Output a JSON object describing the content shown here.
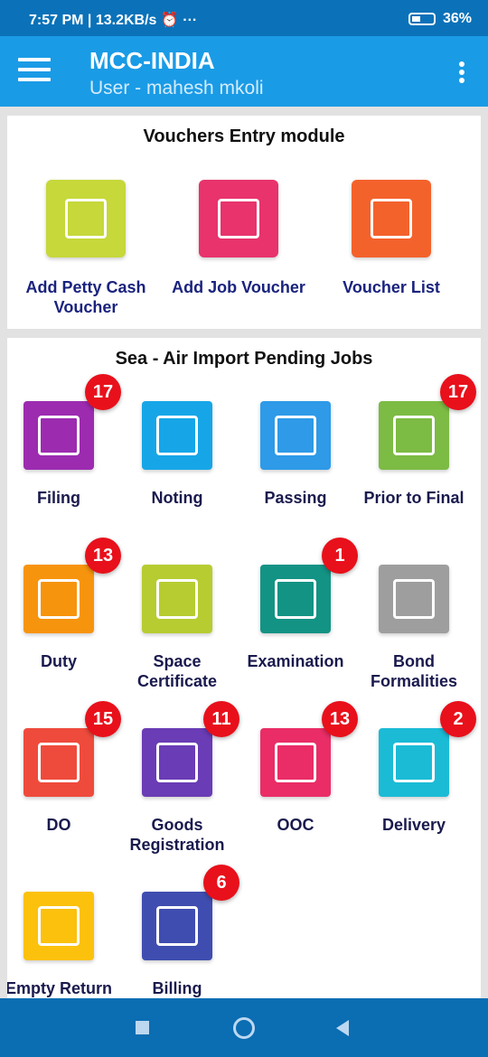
{
  "status": {
    "left": "7:57 PM | 13.2KB/s ⏰ ···",
    "battery": "36%"
  },
  "appbar": {
    "title": "MCC-INDIA",
    "subtitle": "User - mahesh mkoli"
  },
  "vouchers": {
    "heading": "Vouchers Entry module",
    "items": [
      {
        "label": "Add Petty Cash Voucher",
        "color": "#c6d83a",
        "icon": "petty-cash-icon"
      },
      {
        "label": "Add Job Voucher",
        "color": "#e8336d",
        "icon": "job-voucher-icon"
      },
      {
        "label": "Voucher List",
        "color": "#f4622c",
        "icon": "voucher-list-icon"
      }
    ]
  },
  "jobs": {
    "heading": "Sea - Air Import Pending Jobs",
    "items": [
      {
        "label": "Filing",
        "badge": "17",
        "color": "#9c2bb0",
        "icon": "filing-cabinet-icon"
      },
      {
        "label": "Noting",
        "badge": "",
        "color": "#16a6e8",
        "icon": "noting-icon"
      },
      {
        "label": "Passing",
        "badge": "",
        "color": "#2e9ae8",
        "icon": "passing-icon"
      },
      {
        "label": "Prior to Final",
        "badge": "17",
        "color": "#7cbb44",
        "icon": "ticket-icon"
      },
      {
        "label": "Duty",
        "badge": "13",
        "color": "#f7940d",
        "icon": "duty-icon"
      },
      {
        "label": "Space Certificate",
        "badge": "",
        "color": "#b7cc31",
        "icon": "certificate-icon"
      },
      {
        "label": "Examination",
        "badge": "1",
        "color": "#139384",
        "icon": "examination-icon"
      },
      {
        "label": "Bond Formalities",
        "badge": "",
        "color": "#9e9e9e",
        "icon": "bond-icon"
      },
      {
        "label": "DO",
        "badge": "15",
        "color": "#ef4b3c",
        "icon": "do-document-icon"
      },
      {
        "label": "Goods Registration",
        "badge": "11",
        "color": "#6a3cb5",
        "icon": "user-edit-icon"
      },
      {
        "label": "OOC",
        "badge": "13",
        "color": "#ea2d66",
        "icon": "ooc-icon"
      },
      {
        "label": "Delivery",
        "badge": "2",
        "color": "#1bbbd6",
        "icon": "delivery-truck-icon"
      },
      {
        "label": "Empty Return",
        "badge": "",
        "color": "#fbc10d",
        "icon": "container-truck-icon"
      },
      {
        "label": "Billing",
        "badge": "6",
        "color": "#3f4db0",
        "icon": "billing-icon"
      }
    ]
  }
}
